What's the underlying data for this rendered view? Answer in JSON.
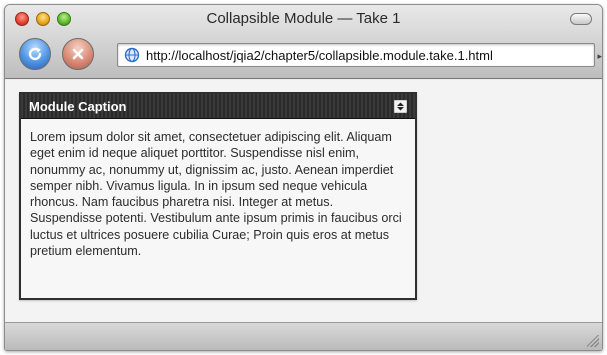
{
  "window": {
    "title": "Collapsible Module — Take 1"
  },
  "toolbar": {
    "reload_icon": "reload-icon",
    "stop_icon": "stop-icon",
    "address_url": "http://localhost/jqia2/chapter5/collapsible.module.take.1.html",
    "site_icon": "globe-icon"
  },
  "module": {
    "caption": "Module Caption",
    "toggle_icon": "collapse-toggle-icon",
    "body_text": "Lorem ipsum dolor sit amet, consectetuer adipiscing elit. Aliquam eget enim id neque aliquet porttitor. Suspendisse nisl enim, nonummy ac, nonummy ut, dignissim ac, justo. Aenean imperdiet semper nibh. Vivamus ligula. In in ipsum sed neque vehicula rhoncus. Nam faucibus pharetra nisi. Integer at metus. Suspendisse potenti. Vestibulum ante ipsum primis in faucibus orci luctus et ultrices posuere cubilia Curae; Proin quis eros at metus pretium elementum."
  },
  "colors": {
    "caption_bar": "#2f2f2f",
    "caption_text": "#ffffff",
    "page_background": "#f3f3f3"
  }
}
